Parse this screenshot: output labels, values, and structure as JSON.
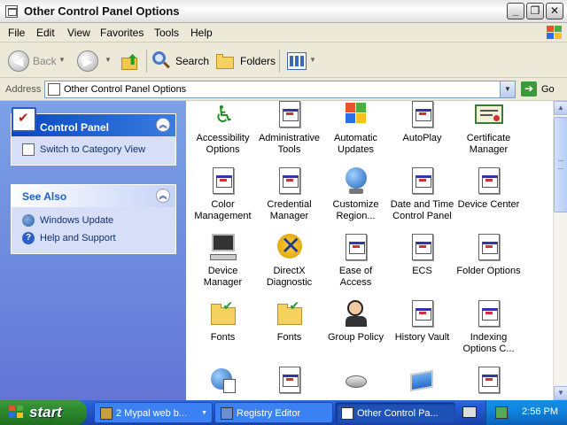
{
  "window": {
    "title": "Other Control Panel Options",
    "buttons": [
      "_",
      "❐",
      "✕"
    ]
  },
  "menubar": {
    "items": [
      "File",
      "Edit",
      "View",
      "Favorites",
      "Tools",
      "Help"
    ]
  },
  "toolbar": {
    "back_label": "Back",
    "search_label": "Search",
    "folders_label": "Folders"
  },
  "addressbar": {
    "label": "Address",
    "value": "Other Control Panel Options",
    "go_label": "Go"
  },
  "taskpane": {
    "control_panel": {
      "title": "Control Panel",
      "tasks": [
        {
          "label": "Switch to Category View",
          "icon": "category-view-icon"
        }
      ]
    },
    "see_also": {
      "title": "See Also",
      "tasks": [
        {
          "label": "Windows Update",
          "icon": "windows-update-icon"
        },
        {
          "label": "Help and Support",
          "icon": "help-icon"
        }
      ]
    }
  },
  "items": [
    {
      "label": "Accessibility Options",
      "icon": "accessibility-icon"
    },
    {
      "label": "Administrative Tools",
      "icon": "document-icon"
    },
    {
      "label": "Automatic Updates",
      "icon": "windows-flag-icon"
    },
    {
      "label": "AutoPlay",
      "icon": "document-icon"
    },
    {
      "label": "Certificate Manager",
      "icon": "certificate-icon"
    },
    {
      "label": "Color Management",
      "icon": "document-icon"
    },
    {
      "label": "Credential Manager",
      "icon": "document-icon"
    },
    {
      "label": "Customize Region...",
      "icon": "globe-icon"
    },
    {
      "label": "Date and Time Control Panel",
      "icon": "document-icon"
    },
    {
      "label": "Device Center",
      "icon": "document-icon"
    },
    {
      "label": "Device Manager",
      "icon": "computer-icon"
    },
    {
      "label": "DirectX Diagnostic",
      "icon": "directx-icon"
    },
    {
      "label": "Ease of Access",
      "icon": "document-icon"
    },
    {
      "label": "ECS",
      "icon": "document-icon"
    },
    {
      "label": "Folder Options",
      "icon": "document-icon"
    },
    {
      "label": "Fonts",
      "icon": "folder-icon"
    },
    {
      "label": "Fonts",
      "icon": "folder-icon"
    },
    {
      "label": "Group Policy",
      "icon": "group-policy-icon"
    },
    {
      "label": "History Vault",
      "icon": "document-icon"
    },
    {
      "label": "Indexing Options C...",
      "icon": "document-icon"
    },
    {
      "label": "",
      "icon": "globe-checklist-icon"
    },
    {
      "label": "",
      "icon": "document-icon"
    },
    {
      "label": "",
      "icon": "mouse-icon"
    },
    {
      "label": "",
      "icon": "network-icon"
    },
    {
      "label": "",
      "icon": "document-icon"
    }
  ],
  "taskbar": {
    "start_label": "start",
    "buttons": [
      {
        "label": "2 Mypal web b...",
        "icon": "browser-icon"
      },
      {
        "label": "Registry Editor",
        "icon": "registry-icon"
      },
      {
        "label": "Other Control Pa...",
        "icon": "control-panel-icon"
      }
    ],
    "clock": "2:56 PM"
  },
  "colors": {
    "taskpane_top": "#7ba2e7",
    "taskpane_bottom": "#6375d6",
    "taskbar_blue": "#245edb",
    "start_green": "#2f8a2f"
  }
}
